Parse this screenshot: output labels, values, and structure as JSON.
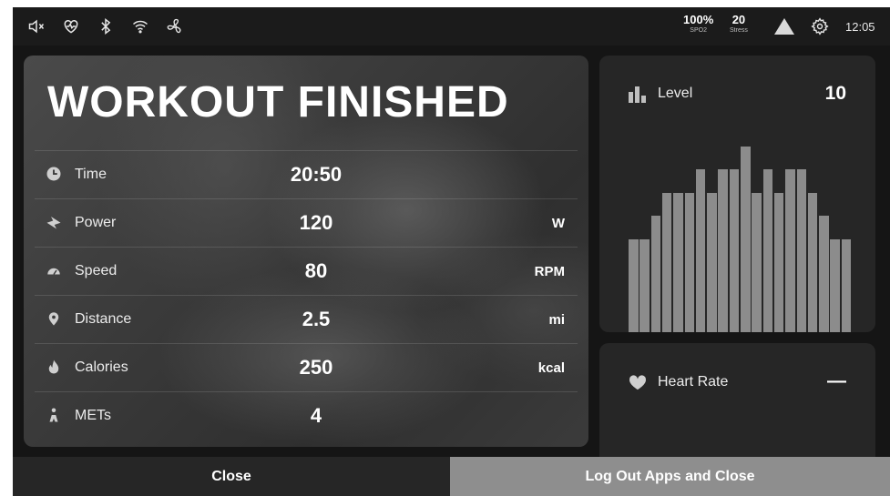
{
  "status_bar": {
    "icons": [
      "speaker-muted-icon",
      "heart-monitor-icon",
      "bluetooth-icon",
      "wifi-icon",
      "fan-icon"
    ],
    "spo2": {
      "value": "100%",
      "label": "SPO2"
    },
    "stress": {
      "value": "20",
      "label": "Stress"
    },
    "time": "12:05"
  },
  "workout": {
    "title": "WORKOUT FINISHED",
    "metrics": [
      {
        "icon": "clock-icon",
        "label": "Time",
        "value": "20:50",
        "unit": ""
      },
      {
        "icon": "power-icon",
        "label": "Power",
        "value": "120",
        "unit": "W"
      },
      {
        "icon": "speedometer-icon",
        "label": "Speed",
        "value": "80",
        "unit": "RPM"
      },
      {
        "icon": "location-pin-icon",
        "label": "Distance",
        "value": "2.5",
        "unit": "mi"
      },
      {
        "icon": "flame-icon",
        "label": "Calories",
        "value": "250",
        "unit": "kcal"
      },
      {
        "icon": "mets-icon",
        "label": "METs",
        "value": "4",
        "unit": ""
      }
    ]
  },
  "level_card": {
    "label": "Level",
    "value": "10",
    "profile": [
      4,
      4,
      5,
      6,
      6,
      6,
      7,
      6,
      7,
      7,
      8,
      6,
      7,
      6,
      7,
      7,
      6,
      5,
      4,
      4
    ],
    "profile_max": 8,
    "bar_color": "#8c8c8c"
  },
  "heart_rate_card": {
    "label": "Heart Rate",
    "value": "—"
  },
  "buttons": {
    "close": "Close",
    "logout": "Log Out Apps and Close"
  },
  "colors": {
    "background": "#151515",
    "card": "#262626",
    "logout_button": "#8e8e8e"
  }
}
